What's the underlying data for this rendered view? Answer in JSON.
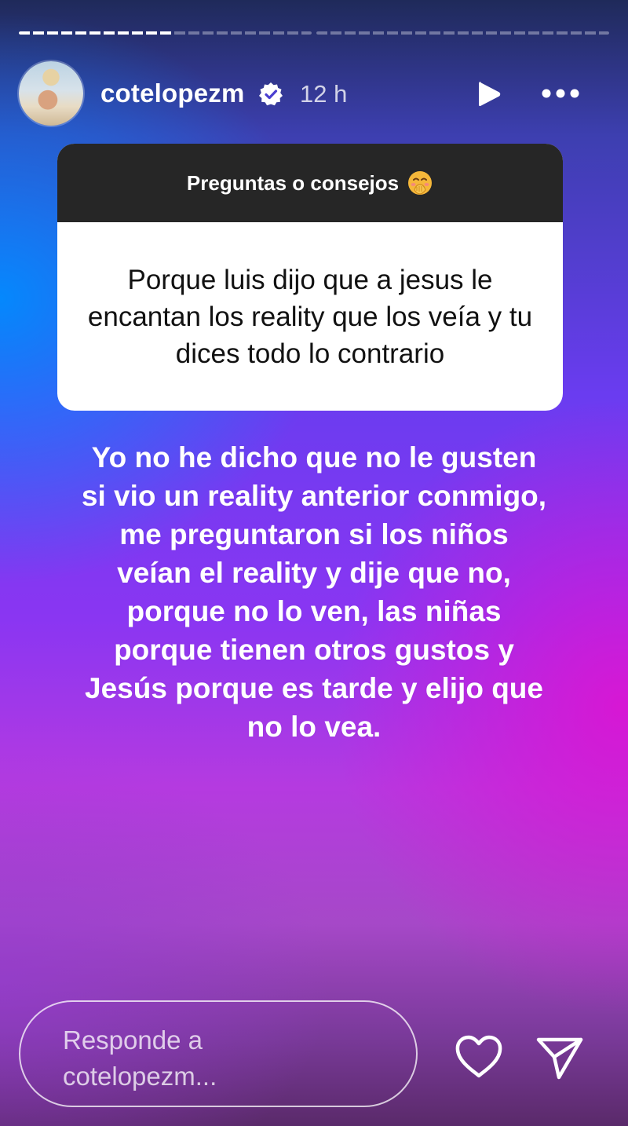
{
  "story": {
    "progress": {
      "segments": 2,
      "active_index": 0,
      "fraction": 0.53
    },
    "author": {
      "username": "cotelopezm",
      "verified": true,
      "time_ago": "12 h"
    },
    "header_icons": {
      "play": "play-icon",
      "more": "more-options-icon",
      "verified": "verified-badge-icon"
    }
  },
  "question_card": {
    "title": "Preguntas o consejos",
    "title_emoji": "hand-over-mouth-emoji",
    "question": "Porque luis dijo que a jesus le encantan los reality que los veía y tu dices todo lo contrario"
  },
  "answer": {
    "text": "Yo no he dicho que no le gusten si vio un reality anterior conmigo, me preguntaron si los niños veían el reality y dije que no, porque no lo ven, las niñas porque tienen otros gustos y Jesús porque es tarde y elijo que no lo vea."
  },
  "reply_bar": {
    "placeholder": "Responde a cotelopezm...",
    "like_icon": "heart-icon",
    "send_icon": "send-icon"
  }
}
